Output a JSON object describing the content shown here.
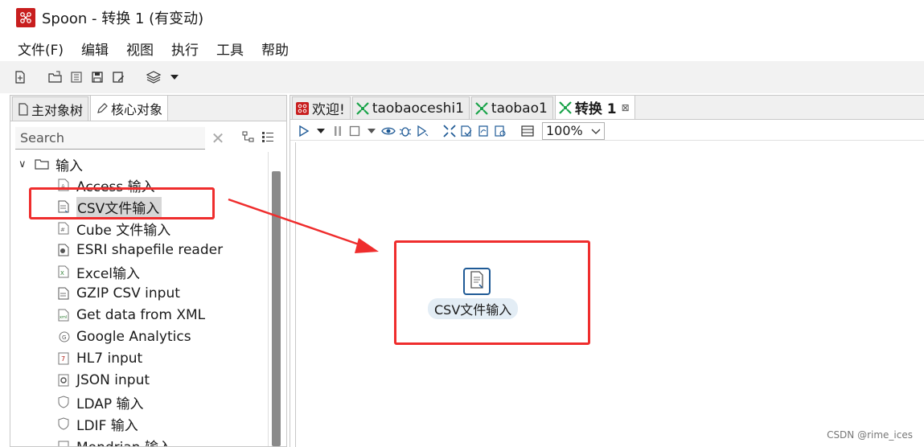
{
  "window": {
    "title": "Spoon - 转换 1 (有变动)"
  },
  "menubar": [
    "文件(F)",
    "编辑",
    "视图",
    "执行",
    "工具",
    "帮助"
  ],
  "left_panel": {
    "tabs": [
      {
        "label": "主对象树",
        "icon": "document-tree-icon",
        "active": false
      },
      {
        "label": "核心对象",
        "icon": "pencil-icon",
        "active": true
      }
    ],
    "search": {
      "placeholder": "Search",
      "value": ""
    },
    "folder": {
      "label": "输入",
      "expanded": true
    },
    "items": [
      {
        "label": "Access 输入",
        "icon": "access-file-icon"
      },
      {
        "label": "CSV文件输入",
        "icon": "csv-file-icon",
        "selected": true
      },
      {
        "label": "Cube 文件输入",
        "icon": "cube-file-icon"
      },
      {
        "label": "ESRI shapefile reader",
        "icon": "shapefile-icon"
      },
      {
        "label": "Excel输入",
        "icon": "excel-file-icon"
      },
      {
        "label": "GZIP CSV input",
        "icon": "gzip-file-icon"
      },
      {
        "label": "Get data from XML",
        "icon": "xml-file-icon"
      },
      {
        "label": "Google Analytics",
        "icon": "google-analytics-icon"
      },
      {
        "label": "HL7 input",
        "icon": "hl7-icon"
      },
      {
        "label": "JSON input",
        "icon": "json-icon"
      },
      {
        "label": "LDAP 输入",
        "icon": "ldap-shield-icon"
      },
      {
        "label": "LDIF 输入",
        "icon": "ldif-shield-icon"
      },
      {
        "label": "Mondrian 输入",
        "icon": "mondrian-icon"
      }
    ]
  },
  "right_panel": {
    "tabs": [
      {
        "label": "欢迎!",
        "icon": "spoon-logo-icon",
        "active": false
      },
      {
        "label": "taobaoceshi1",
        "icon": "transformation-icon",
        "active": false
      },
      {
        "label": "taobao1",
        "icon": "transformation-icon",
        "active": false
      },
      {
        "label": "转换 1",
        "icon": "transformation-icon",
        "active": true,
        "close": "⊠"
      }
    ],
    "zoom": "100%",
    "step": {
      "label": "CSV文件输入",
      "icon": "csv-file-icon"
    }
  },
  "watermark": "CSDN @rime_ices",
  "colors": {
    "highlight": "#ef2d2d",
    "step_border": "#1f5a96",
    "logo": "#c81e1e",
    "transform_green": "#1aa34a"
  }
}
